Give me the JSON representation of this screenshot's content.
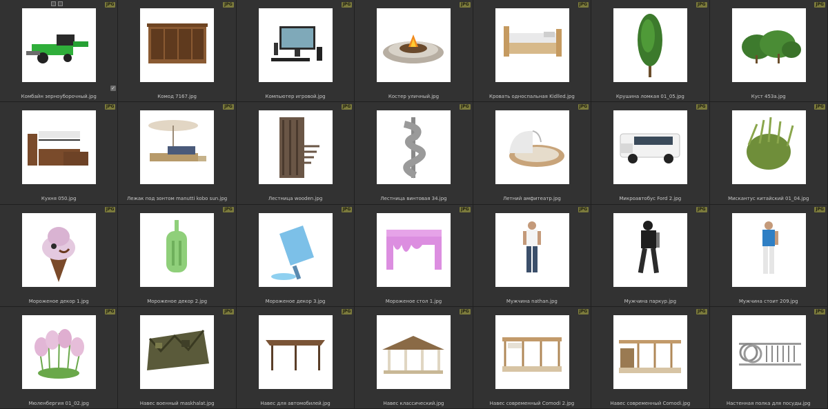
{
  "badge_label": "JPG",
  "colors": {
    "background": "#2f2f2f",
    "badge": "#7b7a3c",
    "caption": "#c8c8c8"
  },
  "toolbar_icons": [
    "square-select-icon",
    "pen-icon"
  ],
  "check_icon": "✓",
  "items": [
    {
      "name": "Комбайн зерноуборочный.jpg",
      "icon": "harvester"
    },
    {
      "name": "Комод 7167.jpg",
      "icon": "dresser"
    },
    {
      "name": "Компьютер игровой.jpg",
      "icon": "computer"
    },
    {
      "name": "Костер уличный.jpg",
      "icon": "firepit"
    },
    {
      "name": "Кровать односпальная Kidlled.jpg",
      "icon": "bed"
    },
    {
      "name": "Крушина ломкая 01_05.jpg",
      "icon": "tree"
    },
    {
      "name": "Куст 453a.jpg",
      "icon": "bush"
    },
    {
      "name": "Кухня 050.jpg",
      "icon": "kitchen"
    },
    {
      "name": "Лежак под зонтом manutti kobo sun.jpg",
      "icon": "lounger"
    },
    {
      "name": "Лестница wooden.jpg",
      "icon": "stairs"
    },
    {
      "name": "Лестница винтовая 34.jpg",
      "icon": "spiral"
    },
    {
      "name": "Летний амфитеатр.jpg",
      "icon": "amphitheater"
    },
    {
      "name": "Микроавтобус Ford 2.jpg",
      "icon": "van"
    },
    {
      "name": "Мискантус китайский 01_04.jpg",
      "icon": "grass"
    },
    {
      "name": "Мороженое декор 1.jpg",
      "icon": "icecream"
    },
    {
      "name": "Мороженое декор 2.jpg",
      "icon": "popsicle-green"
    },
    {
      "name": "Мороженое декор 3.jpg",
      "icon": "popsicle-blue"
    },
    {
      "name": "Мороженое стол 1.jpg",
      "icon": "drip-table"
    },
    {
      "name": "Мужчина nathan.jpg",
      "icon": "man-white"
    },
    {
      "name": "Мужчина паркур.jpg",
      "icon": "man-black"
    },
    {
      "name": "Мужчина стоит 209.jpg",
      "icon": "man-blue"
    },
    {
      "name": "Мюленбергия 01_02.jpg",
      "icon": "pink-grass"
    },
    {
      "name": "Навес военный maskhalat.jpg",
      "icon": "camo-tent"
    },
    {
      "name": "Навес для автомобилей.jpg",
      "icon": "carport"
    },
    {
      "name": "Навес классический.jpg",
      "icon": "gazebo"
    },
    {
      "name": "Навес современный Comodi 2.jpg",
      "icon": "pergola"
    },
    {
      "name": "Навес современный Comodi.jpg",
      "icon": "pergola2"
    },
    {
      "name": "Настенная полка для посуды.jpg",
      "icon": "dishrack"
    }
  ]
}
